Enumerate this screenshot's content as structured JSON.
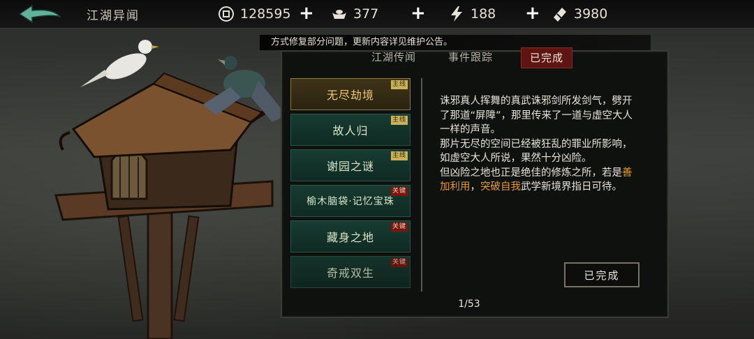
{
  "header": {
    "title": "江湖异闻",
    "back_icon": "back-arrow-icon"
  },
  "resources": [
    {
      "icon": "coin-icon",
      "value": "128595"
    },
    {
      "icon": "silver-ingot-icon",
      "value": "377"
    },
    {
      "icon": "lightning-icon",
      "value": "188"
    },
    {
      "icon": "ticket-icon",
      "value": "3980"
    }
  ],
  "plus_label": "+",
  "ticker": "方式修复部分问题，更新内容详见维护公告。",
  "tabs": [
    {
      "label": "江湖传闻",
      "active": false
    },
    {
      "label": "事件跟踪",
      "active": false
    },
    {
      "label": "已完成",
      "active": true
    }
  ],
  "quests": [
    {
      "name": "无尽劫境",
      "tag": "主线",
      "tag_type": "main",
      "selected": true
    },
    {
      "name": "故人归",
      "tag": "主线",
      "tag_type": "main",
      "selected": false
    },
    {
      "name": "谢园之谜",
      "tag": "主线",
      "tag_type": "main",
      "selected": false
    },
    {
      "name": "榆木脑袋·记忆宝珠",
      "tag": "关键",
      "tag_type": "key",
      "selected": false
    },
    {
      "name": "藏身之地",
      "tag": "关键",
      "tag_type": "key",
      "selected": false
    },
    {
      "name": "奇戒双生",
      "tag": "关键",
      "tag_type": "key",
      "selected": false
    }
  ],
  "description": {
    "para1": "诛邪真人挥舞的真武诛邪剑所发剑气，劈开了那道“屏障”，那里传来了一道与虚空大人一样的声音。",
    "para2": "那片无尽的空间已经被狂乱的罪业所影响，如虚空大人所说，果然十分凶险。",
    "para3_a": "但凶险之地也正是绝佳的修炼之所，若是",
    "para3_h1": "善加利用",
    "para3_b": "，",
    "para3_h2": "突破自我",
    "para3_c": "武学新境界指日可待。"
  },
  "completed_button": "已完成",
  "pager": "1/53",
  "colors": {
    "highlight": "#e39a2a",
    "active_tab": "#5e1412",
    "quest_bg": "#173c32",
    "quest_selected": "#3f3418"
  }
}
